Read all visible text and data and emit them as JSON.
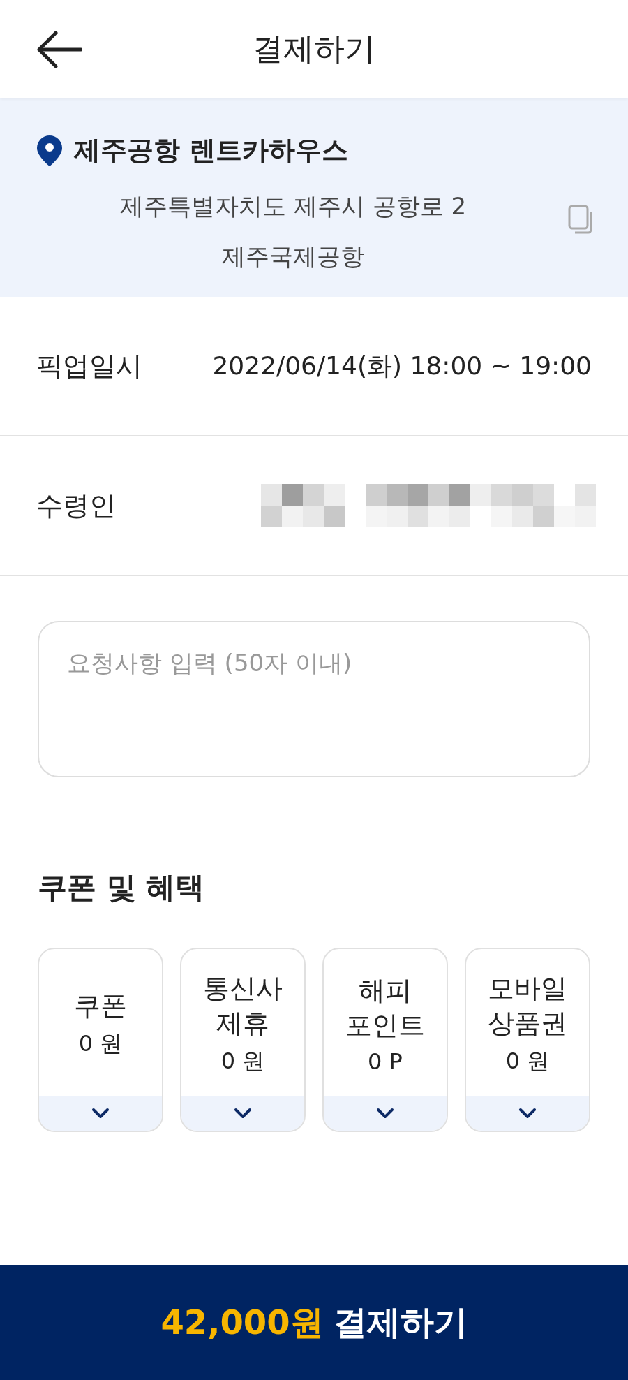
{
  "header": {
    "title": "결제하기"
  },
  "location": {
    "name": "제주공항 렌트카하우스",
    "address_lines": [
      "제주특별자치도 제주시 공항로 2",
      "제주국제공항"
    ]
  },
  "rows": [
    {
      "kind": "text",
      "label": "픽업일시",
      "value": "2022/06/14(화) 18:00 ~ 19:00"
    },
    {
      "kind": "redacted",
      "label": "수령인"
    }
  ],
  "request": {
    "placeholder": "요청사항 입력 (50자 이내)"
  },
  "benefits": {
    "title": "쿠폰 및 혜택",
    "items": [
      {
        "title_lines": [
          "쿠폰"
        ],
        "amount": "0 원"
      },
      {
        "title_lines": [
          "통신사",
          "제휴"
        ],
        "amount": "0 원"
      },
      {
        "title_lines": [
          "해피",
          "포인트"
        ],
        "amount": "0 P"
      },
      {
        "title_lines": [
          "모바일",
          "상품권"
        ],
        "amount": "0 원"
      }
    ]
  },
  "pay_button": {
    "amount": "42,000원",
    "label": "결제하기"
  }
}
